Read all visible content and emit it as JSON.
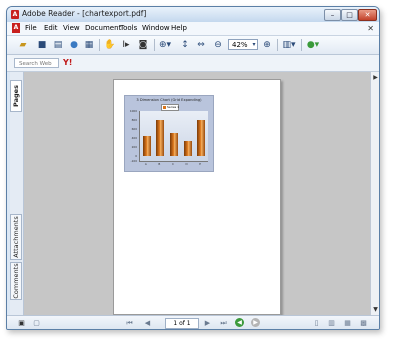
{
  "window": {
    "title": "Adobe Reader - [chartexport.pdf]",
    "app_icon_glyph": "A",
    "controls": {
      "minimize": "–",
      "maximize": "□",
      "close": "✕"
    }
  },
  "menu": {
    "items": [
      "File",
      "Edit",
      "View",
      "Document",
      "Tools",
      "Window",
      "Help"
    ],
    "doc_icon_glyph": "A",
    "close_glyph": "✕"
  },
  "toolbar": {
    "zoom_value": "42%",
    "icons": [
      "open-folder-icon",
      "save-icon",
      "print-icon",
      "email-icon",
      "hand-tool-icon",
      "select-text-icon",
      "snapshot-icon",
      "zoom-in-icon",
      "fit-width-icon",
      "fit-page-icon",
      "zoom-out-icon",
      "zoom-increase-icon",
      "page-display-icon",
      "help-icon"
    ]
  },
  "search": {
    "placeholder": "Search Web",
    "provider_logo": "Y!"
  },
  "left_tabs": {
    "pages": "Pages",
    "attachments": "Attachments",
    "comments": "Comments"
  },
  "status": {
    "page_indicator": "1 of 1"
  },
  "chart_data": {
    "type": "bar",
    "title": "3 Dimension Chart (Grid Expanding)",
    "legend": [
      "Series 1"
    ],
    "categories": [
      "A",
      "B",
      "C",
      "D",
      "E"
    ],
    "values": [
      450,
      800,
      520,
      350,
      800
    ],
    "ylim": [
      -100,
      1000
    ],
    "yticks": [
      "1000",
      "800",
      "600",
      "400",
      "200",
      "0",
      "-100"
    ],
    "grid": true,
    "legend_position": "top"
  },
  "colors": {
    "bar": "#d9741b",
    "chart_background": "#b9c4dc",
    "workspace": "#c6c6c6"
  }
}
